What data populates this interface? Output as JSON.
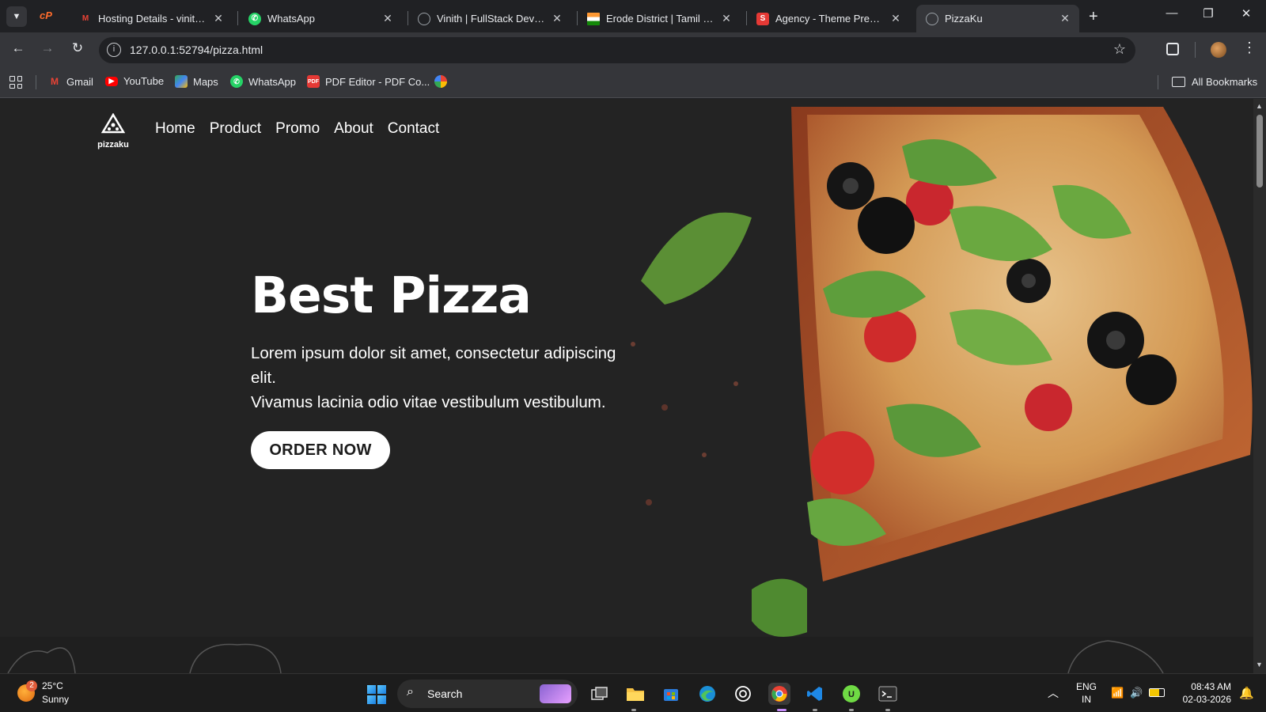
{
  "browser": {
    "tabs": [
      {
        "title": "Hosting Details - vinithku",
        "favicon": "gmail-icon",
        "favicon_color": "#ea4335",
        "active": false
      },
      {
        "title": "WhatsApp",
        "favicon": "whatsapp-icon",
        "favicon_color": "#25d366",
        "active": false
      },
      {
        "title": "Vinith | FullStack Develop",
        "favicon": "globe-icon",
        "favicon_color": "#9aa0a6",
        "active": false
      },
      {
        "title": "Erode District | Tamil Nad",
        "favicon": "india-flag-icon",
        "favicon_color": "#ff9933",
        "active": false
      },
      {
        "title": "Agency - Theme Preview",
        "favicon": "s-logo-icon",
        "favicon_color": "#e53935",
        "active": false
      },
      {
        "title": "PizzaKu",
        "favicon": "globe-icon",
        "favicon_color": "#9aa0a6",
        "active": true
      }
    ],
    "url": "127.0.0.1:52794/pizza.html",
    "bookmarks": [
      {
        "label": "Gmail",
        "icon": "gmail-icon",
        "color": "#ea4335"
      },
      {
        "label": "YouTube",
        "icon": "youtube-icon",
        "color": "#ff0000"
      },
      {
        "label": "Maps",
        "icon": "maps-icon",
        "color": "#34a853"
      },
      {
        "label": "WhatsApp",
        "icon": "whatsapp-icon",
        "color": "#25d366"
      },
      {
        "label": "PDF Editor - PDF Co...",
        "icon": "pdf-icon",
        "color": "#e53935"
      },
      {
        "label": "",
        "icon": "pinwheel-icon",
        "color": "#fbbc05"
      }
    ],
    "all_bookmarks": "All Bookmarks"
  },
  "page": {
    "logo_text": "pizzaku",
    "nav": [
      "Home",
      "Product",
      "Promo",
      "About",
      "Contact"
    ],
    "hero": {
      "title": "Best Pizza",
      "subtitle_line1": "Lorem ipsum dolor sit amet, consectetur adipiscing elit.",
      "subtitle_line2": "Vivamus lacinia odio vitae vestibulum vestibulum.",
      "cta": "ORDER NOW"
    },
    "colors": {
      "background": "#232323",
      "text": "#ffffff",
      "button_bg": "#ffffff",
      "button_text": "#1c1c1c"
    }
  },
  "taskbar": {
    "weather": {
      "temp": "25°C",
      "desc": "Sunny",
      "badge": "2"
    },
    "search_label": "Search",
    "apps": [
      "task-view-icon",
      "file-explorer-icon",
      "microsoft-store-icon",
      "edge-icon",
      "chatgpt-icon",
      "chrome-icon",
      "vscode-icon",
      "upwork-icon",
      "terminal-icon"
    ],
    "language": {
      "line1": "ENG",
      "line2": "IN"
    },
    "time": "08:43 AM",
    "date": "02-03-2026"
  }
}
